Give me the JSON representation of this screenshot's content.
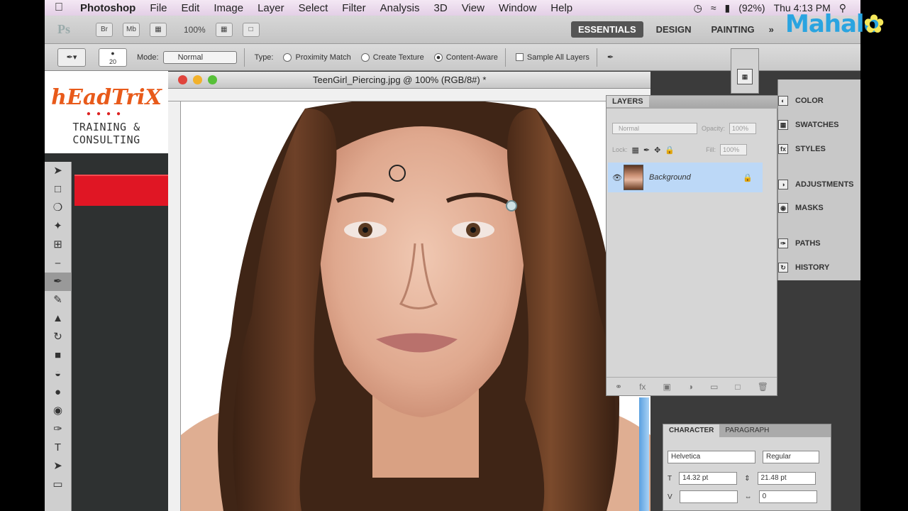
{
  "menubar": {
    "app": "Photoshop",
    "items": [
      "File",
      "Edit",
      "Image",
      "Layer",
      "Select",
      "Filter",
      "Analysis",
      "3D",
      "View",
      "Window",
      "Help"
    ],
    "battery": "(92%)",
    "clock": "Thu 4:13 PM"
  },
  "appbar": {
    "zoom": "100%",
    "workspaces": [
      "ESSENTIALS",
      "DESIGN",
      "PAINTING"
    ]
  },
  "watermark": "Mahalo",
  "options": {
    "brush_size": "20",
    "mode_label": "Mode:",
    "mode_value": "Normal",
    "type_label": "Type:",
    "radio_proximity": "Proximity Match",
    "radio_texture": "Create Texture",
    "radio_content": "Content-Aware",
    "sample_all": "Sample All Layers"
  },
  "brand": {
    "logo": "hEadTriX",
    "tagline": "TRAINING & CONSULTING"
  },
  "document": {
    "title": "TeenGirl_Piercing.jpg @ 100% (RGB/8#) *"
  },
  "layers_panel": {
    "tab": "LAYERS",
    "blend": "Normal",
    "opacity_label": "Opacity:",
    "opacity": "100%",
    "lock_label": "Lock:",
    "fill_label": "Fill:",
    "fill": "100%",
    "layer_name": "Background"
  },
  "dock": {
    "items": [
      "COLOR",
      "SWATCHES",
      "STYLES",
      "ADJUSTMENTS",
      "MASKS",
      "PATHS",
      "HISTORY"
    ]
  },
  "character": {
    "tab1": "CHARACTER",
    "tab2": "PARAGRAPH",
    "font": "Helvetica",
    "style": "Regular",
    "size": "14.32 pt",
    "leading": "21.48 pt",
    "tracking": "0"
  },
  "colors": {
    "selection_blue": "#bcd8f7",
    "brand_red": "#e01624",
    "mahalo_blue": "#2aa4e0"
  }
}
